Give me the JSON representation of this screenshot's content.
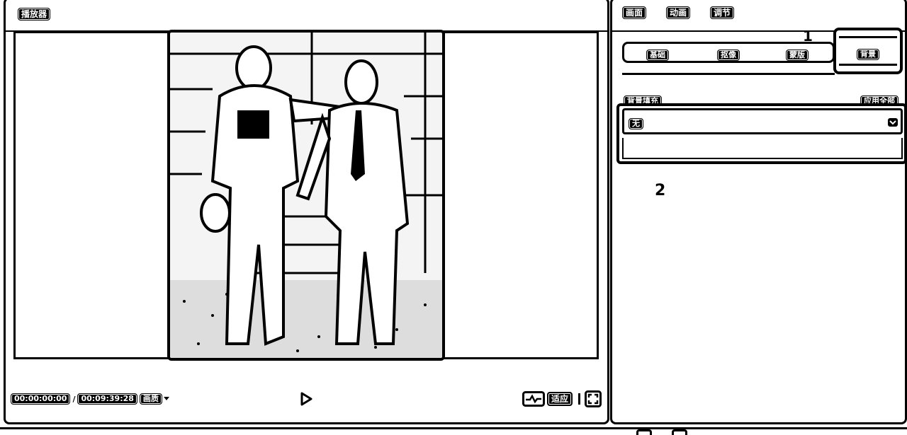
{
  "player": {
    "title": "播放器",
    "time_current": "00:00:00:00",
    "time_separator": "/",
    "time_total": "00:09:39:28",
    "quality_label": "画质",
    "fit_label": "适应"
  },
  "inspector": {
    "top_tabs": [
      "画面",
      "动画",
      "调节"
    ],
    "sub_tabs": [
      "基础",
      "抠像",
      "蒙版",
      "背景"
    ],
    "section_title": "背景填充",
    "apply_all": "应用全部",
    "fill_select_value": "无",
    "annotation_1": "1",
    "annotation_2": "2"
  },
  "icons": {
    "play": "play-icon",
    "waveform": "waveform-icon",
    "fullscreen": "fullscreen-icon",
    "dropdown": "chevron-down-icon"
  }
}
